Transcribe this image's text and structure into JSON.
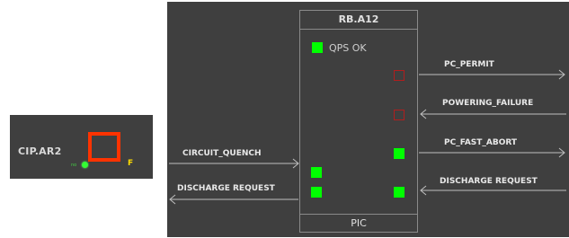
{
  "cip": {
    "title": "CIP.AR2",
    "flag": "F",
    "lamp_label": "no"
  },
  "pic": {
    "title": "RB.A12",
    "footer": "PIC",
    "qps_label": "QPS OK",
    "colors": {
      "on": "#00ff00",
      "off": "#b01e1e",
      "background": "#3f3f3f"
    }
  },
  "signals": {
    "pc_permit": "PC_PERMIT",
    "powering_failure": "POWERING_FAILURE",
    "pc_fast_abort": "PC_FAST_ABORT",
    "discharge_request_out": "DISCHARGE REQUEST",
    "circuit_quench": "CIRCUIT_QUENCH",
    "discharge_request_in": "DISCHARGE REQUEST"
  }
}
